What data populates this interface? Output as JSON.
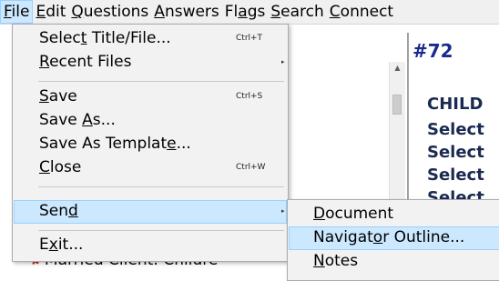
{
  "menubar": {
    "items": [
      {
        "pre": "",
        "u": "F",
        "post": "ile"
      },
      {
        "pre": "",
        "u": "E",
        "post": "dit"
      },
      {
        "pre": "",
        "u": "Q",
        "post": "uestions"
      },
      {
        "pre": "",
        "u": "A",
        "post": "nswers"
      },
      {
        "pre": "Fl",
        "u": "a",
        "post": "gs"
      },
      {
        "pre": "",
        "u": "S",
        "post": "earch"
      },
      {
        "pre": "",
        "u": "C",
        "post": "onnect"
      }
    ]
  },
  "file_menu": {
    "select_title": {
      "pre": "Selec",
      "u": "t",
      "post": " Title/File...",
      "shortcut": "Ctrl+T"
    },
    "recent_files": {
      "pre": "",
      "u": "R",
      "post": "ecent Files"
    },
    "save": {
      "pre": "",
      "u": "S",
      "post": "ave",
      "shortcut": "Ctrl+S"
    },
    "save_as": {
      "pre": "Save ",
      "u": "A",
      "post": "s..."
    },
    "save_as_template": {
      "pre": "Save As Templat",
      "u": "e",
      "post": "..."
    },
    "close": {
      "pre": "",
      "u": "C",
      "post": "lose",
      "shortcut": "Ctrl+W"
    },
    "send": {
      "pre": "Sen",
      "u": "d",
      "post": ""
    },
    "exit": {
      "pre": "E",
      "u": "x",
      "post": "it..."
    }
  },
  "send_menu": {
    "document": {
      "pre": "",
      "u": "D",
      "post": "ocument"
    },
    "navigator_outline": {
      "pre": "Navigat",
      "u": "o",
      "post": "r Outline..."
    },
    "notes": {
      "pre": "",
      "u": "N",
      "post": "otes"
    }
  },
  "tree": {
    "item_label": "Married Client: Childre",
    "item_marker": "✘"
  },
  "doc": {
    "number": "#72",
    "lines": [
      "CHILD",
      "Select",
      "Select",
      "Select",
      "Select"
    ]
  },
  "icons": {
    "submenu_arrow": "▸",
    "scroll_up_arrow": "▲"
  },
  "colors": {
    "highlight": "#cce8ff",
    "highlight_border": "#99d1ff",
    "doc_heading": "#1a2a8c"
  }
}
